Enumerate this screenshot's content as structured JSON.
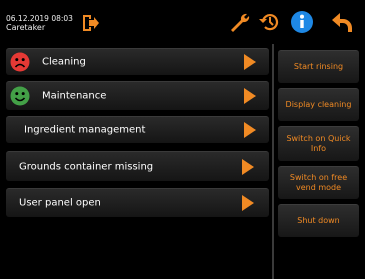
{
  "header": {
    "datetime": "06.12.2019 08:03",
    "user": "Caretaker",
    "icons": [
      "logout-icon",
      "wrench-icon",
      "history-icon",
      "info-icon",
      "back-icon"
    ]
  },
  "colors": {
    "accent": "#f08a24",
    "info": "#1e88e5",
    "sad": "#e53935",
    "happy": "#43a047"
  },
  "list": [
    {
      "label": "Cleaning",
      "status": "sad-face-icon"
    },
    {
      "label": "Maintenance",
      "status": "happy-face-icon"
    },
    {
      "label": "Ingredient management"
    },
    {
      "label": "Grounds container missing"
    },
    {
      "label": "User panel open"
    }
  ],
  "actions": [
    "Start rinsing",
    "Display cleaning",
    "Switch on Quick Info",
    "Switch on free vend mode",
    "Shut down"
  ]
}
